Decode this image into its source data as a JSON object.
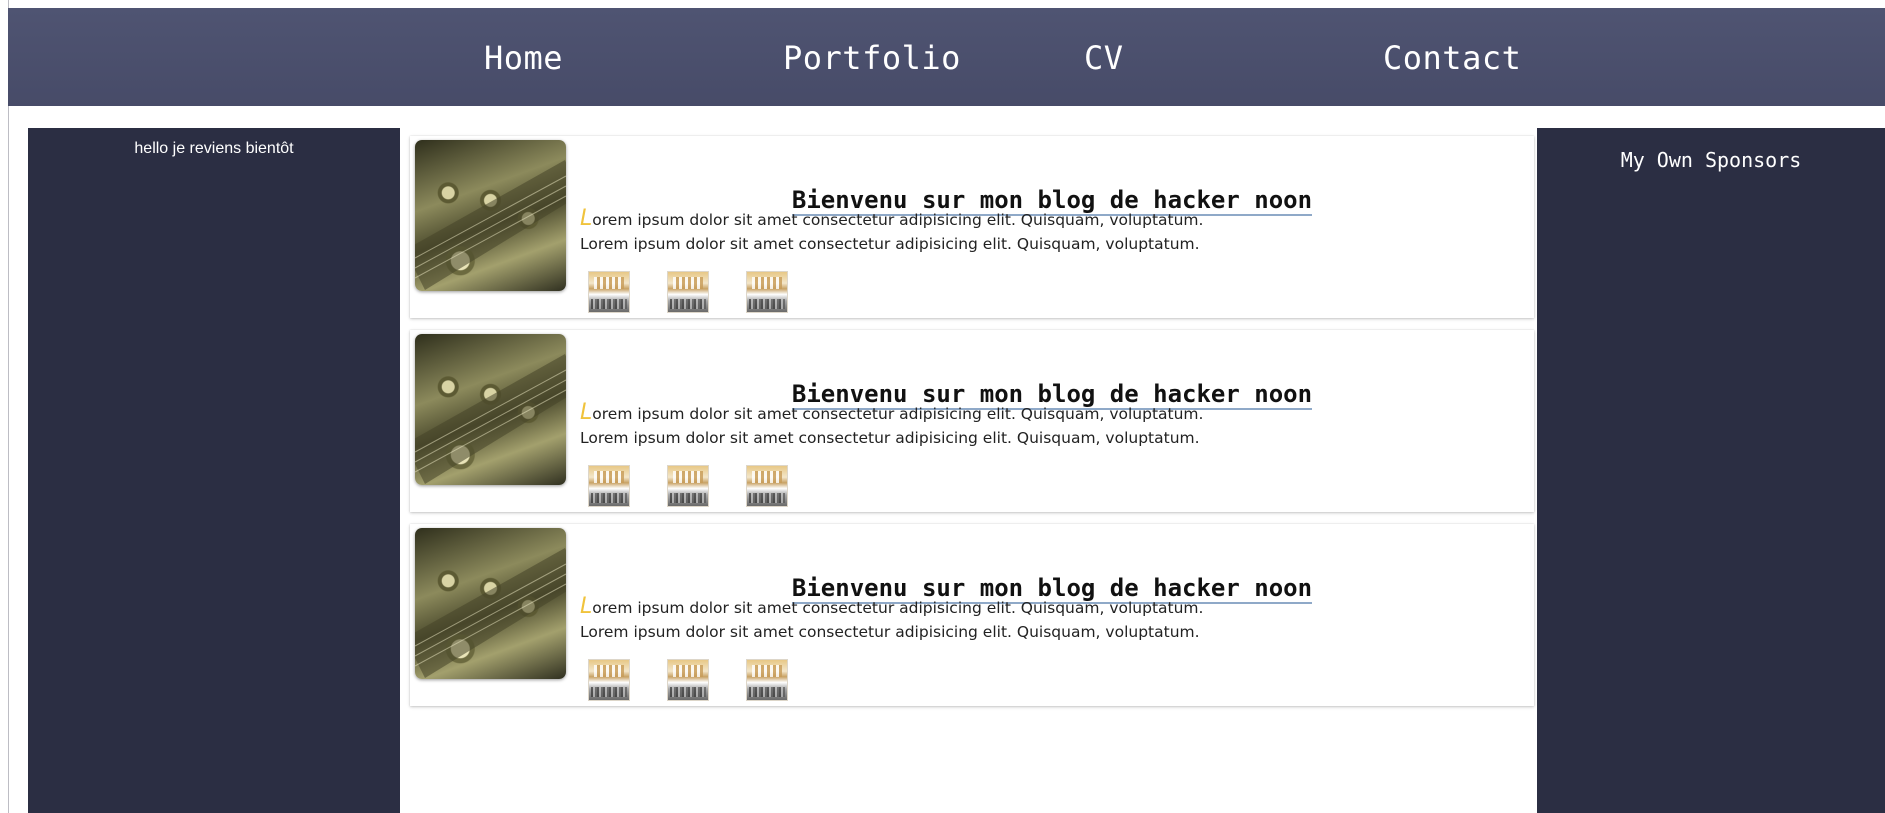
{
  "nav": {
    "items": [
      {
        "label": "Home"
      },
      {
        "label": "Portfolio"
      },
      {
        "label": "CV"
      },
      {
        "label": "Contact"
      }
    ]
  },
  "left_sidebar": {
    "text": "hello je reviens bientôt"
  },
  "right_sidebar": {
    "title": "My Own Sponsors"
  },
  "articles": [
    {
      "title": "Bienvenu sur mon blog de hacker noon",
      "drop_letter": "L",
      "line1_rest": "orem ipsum dolor sit amet consectetur adipisicing elit. Quisquam, voluptatum.",
      "line2": "Lorem ipsum dolor sit amet consectetur adipisicing elit. Quisquam, voluptatum.",
      "thumbnail": "guitar-headstock-image",
      "gallery": [
        "station-hall-thumbnail",
        "station-hall-thumbnail",
        "station-hall-thumbnail"
      ]
    },
    {
      "title": "Bienvenu sur mon blog de hacker noon",
      "drop_letter": "L",
      "line1_rest": "orem ipsum dolor sit amet consectetur adipisicing elit. Quisquam, voluptatum.",
      "line2": "Lorem ipsum dolor sit amet consectetur adipisicing elit. Quisquam, voluptatum.",
      "thumbnail": "guitar-headstock-image",
      "gallery": [
        "station-hall-thumbnail",
        "station-hall-thumbnail",
        "station-hall-thumbnail"
      ]
    },
    {
      "title": "Bienvenu sur mon blog de hacker noon",
      "drop_letter": "L",
      "line1_rest": "orem ipsum dolor sit amet consectetur adipisicing elit. Quisquam, voluptatum.",
      "line2": "Lorem ipsum dolor sit amet consectetur adipisicing elit. Quisquam, voluptatum.",
      "thumbnail": "guitar-headstock-image",
      "gallery": [
        "station-hall-thumbnail",
        "station-hall-thumbnail",
        "station-hall-thumbnail"
      ]
    }
  ],
  "colors": {
    "navbar_bg": "#4b4f6c",
    "sidebar_bg": "#2b2e43",
    "drop_letter": "#f0c33c",
    "title_underline": "#8fa9c8"
  }
}
